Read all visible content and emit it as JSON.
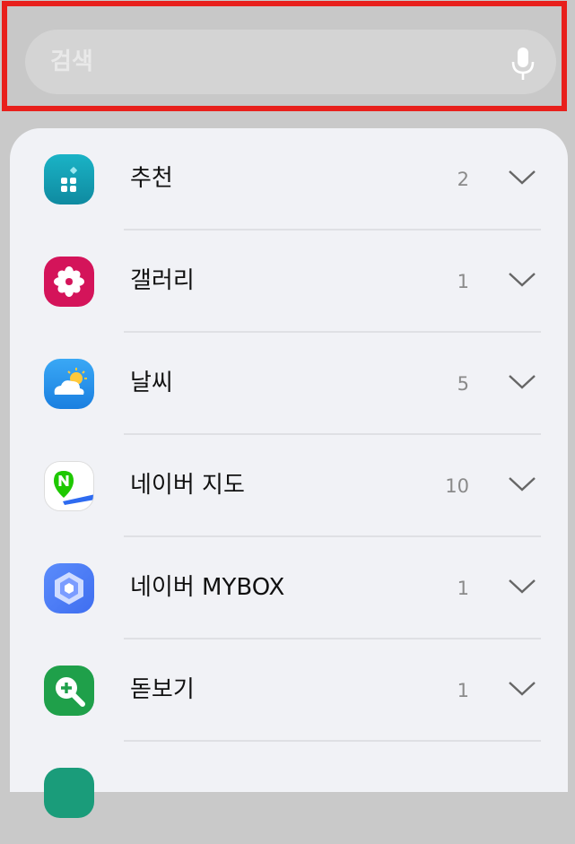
{
  "search": {
    "placeholder": "검색",
    "mic_icon": "microphone-icon"
  },
  "colors": {
    "highlight_border": "#e8201c",
    "panel_background": "#f1f2f6",
    "count_text": "#8a8a8a"
  },
  "apps": [
    {
      "label": "추천",
      "count": "2",
      "icon": "recommend-icon",
      "color": "#17a2b8"
    },
    {
      "label": "갤러리",
      "count": "1",
      "icon": "gallery-icon",
      "color": "#d4145a"
    },
    {
      "label": "날씨",
      "count": "5",
      "icon": "weather-icon",
      "color": "#2f9bf0"
    },
    {
      "label": "네이버 지도",
      "count": "10",
      "icon": "naver-map-icon",
      "color": "#1ec800"
    },
    {
      "label": "네이버 MYBOX",
      "count": "1",
      "icon": "naver-mybox-icon",
      "color": "#4a7bf7"
    },
    {
      "label": "돋보기",
      "count": "1",
      "icon": "magnifier-icon",
      "color": "#1fa04a"
    }
  ]
}
